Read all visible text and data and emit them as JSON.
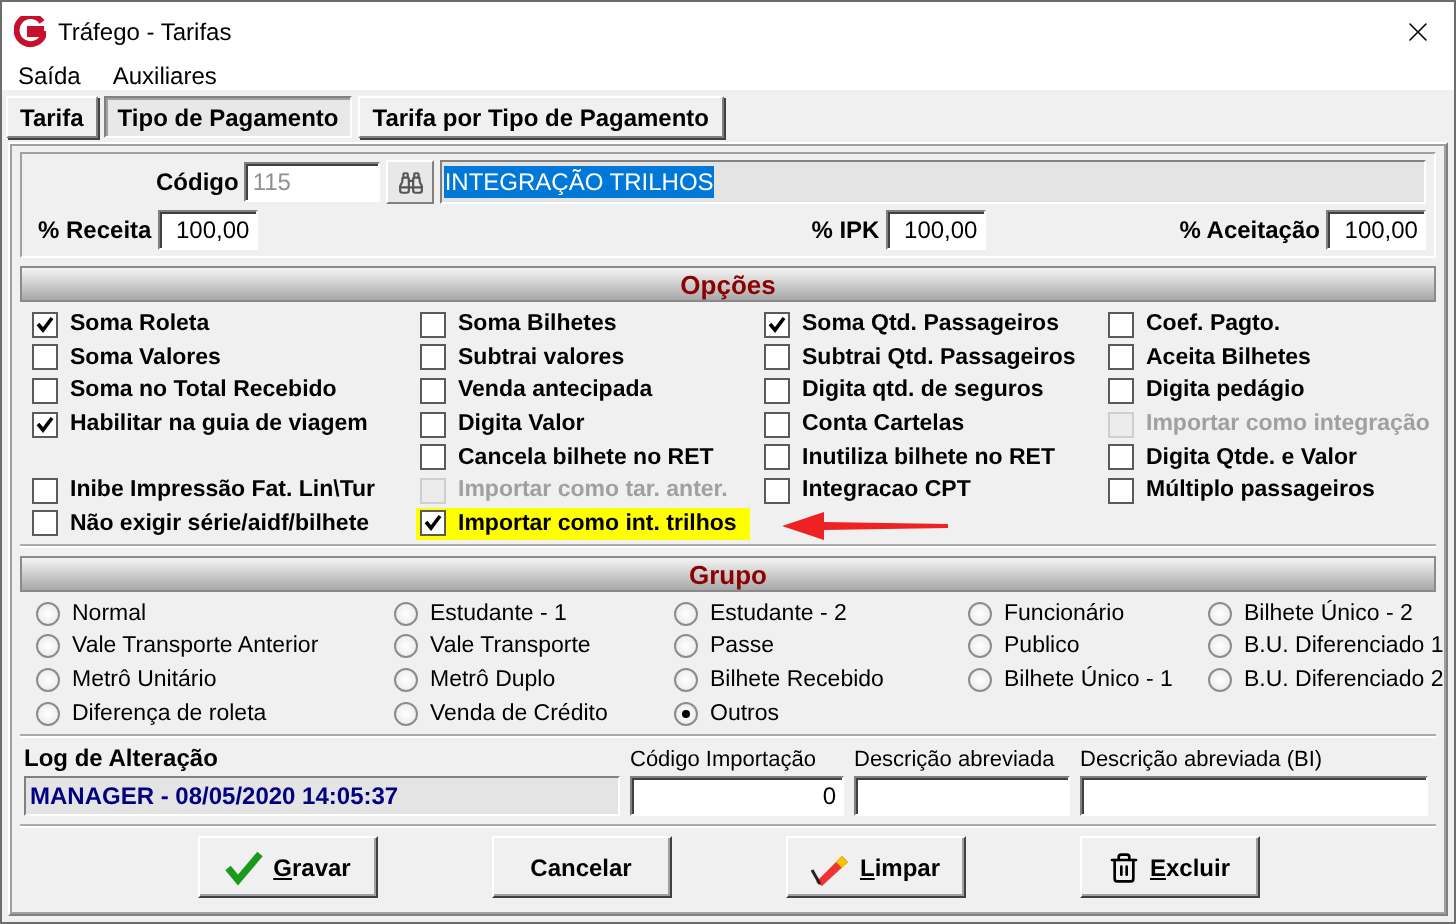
{
  "window": {
    "title": "Tráfego - Tarifas"
  },
  "menu": [
    "Saída",
    "Auxiliares"
  ],
  "tabs": [
    {
      "label": "Tarifa",
      "selected": false
    },
    {
      "label": "Tipo de Pagamento",
      "selected": true
    },
    {
      "label": "Tarifa por Tipo de Pagamento",
      "selected": false
    }
  ],
  "header": {
    "code_label": "Código",
    "code": "115",
    "description": "INTEGRAÇÃO TRILHOS",
    "fields": [
      {
        "label": "% Receita",
        "value": "100,00"
      },
      {
        "label": "% IPK",
        "value": "100,00"
      },
      {
        "label": "% Aceitação",
        "value": "100,00"
      }
    ]
  },
  "options": {
    "title": "Opções",
    "columns": [
      {
        "items": [
          {
            "label": "Soma Roleta",
            "checked": true,
            "disabled": false,
            "highlighted": false
          },
          {
            "label": "Soma Valores",
            "checked": false,
            "disabled": false,
            "highlighted": false
          },
          {
            "label": "Soma no Total Recebido",
            "checked": false,
            "disabled": false,
            "highlighted": false
          },
          {
            "label": "Habilitar na guia de viagem",
            "checked": true,
            "disabled": false,
            "highlighted": false
          }
        ],
        "lower_items": [
          {
            "label": "Inibe Impressão Fat. Lin\\Tur",
            "checked": false,
            "disabled": false,
            "highlighted": false
          },
          {
            "label": "Não exigir série/aidf/bilhete",
            "checked": false,
            "disabled": false,
            "highlighted": false
          }
        ]
      },
      {
        "items": [
          {
            "label": "Soma Bilhetes",
            "checked": false,
            "disabled": false,
            "highlighted": false
          },
          {
            "label": "Subtrai valores",
            "checked": false,
            "disabled": false,
            "highlighted": false
          },
          {
            "label": "Venda antecipada",
            "checked": false,
            "disabled": false,
            "highlighted": false
          },
          {
            "label": "Digita Valor",
            "checked": false,
            "disabled": false,
            "highlighted": false
          },
          {
            "label": "Cancela bilhete no RET",
            "checked": false,
            "disabled": false,
            "highlighted": false
          },
          {
            "label": "Importar como tar. anter.",
            "checked": false,
            "disabled": true,
            "highlighted": false
          },
          {
            "label": "Importar como int. trilhos",
            "checked": true,
            "disabled": false,
            "highlighted": true
          }
        ]
      },
      {
        "items": [
          {
            "label": "Soma Qtd. Passageiros",
            "checked": true,
            "disabled": false,
            "highlighted": false
          },
          {
            "label": "Subtrai Qtd. Passageiros",
            "checked": false,
            "disabled": false,
            "highlighted": false
          },
          {
            "label": "Digita qtd. de seguros",
            "checked": false,
            "disabled": false,
            "highlighted": false
          },
          {
            "label": "Conta Cartelas",
            "checked": false,
            "disabled": false,
            "highlighted": false
          },
          {
            "label": "Inutiliza bilhete no RET",
            "checked": false,
            "disabled": false,
            "highlighted": false
          },
          {
            "label": "Integracao CPT",
            "checked": false,
            "disabled": false,
            "highlighted": false
          }
        ]
      },
      {
        "items": [
          {
            "label": "Coef. Pagto.",
            "checked": false,
            "disabled": false,
            "highlighted": false
          },
          {
            "label": "Aceita Bilhetes",
            "checked": false,
            "disabled": false,
            "highlighted": false
          },
          {
            "label": "Digita pedágio",
            "checked": false,
            "disabled": false,
            "highlighted": false
          },
          {
            "label": "Importar como integração",
            "checked": false,
            "disabled": true,
            "highlighted": false
          },
          {
            "label": "Digita Qtde. e Valor",
            "checked": false,
            "disabled": false,
            "highlighted": false
          },
          {
            "label": "Múltiplo passageiros",
            "checked": false,
            "disabled": false,
            "highlighted": false
          }
        ]
      }
    ]
  },
  "group": {
    "title": "Grupo",
    "columns": [
      [
        {
          "label": "Normal",
          "selected": false
        },
        {
          "label": "Vale Transporte Anterior",
          "selected": false
        },
        {
          "label": "Metrô Unitário",
          "selected": false
        },
        {
          "label": "Diferença de roleta",
          "selected": false
        }
      ],
      [
        {
          "label": "Estudante - 1",
          "selected": false
        },
        {
          "label": "Vale Transporte",
          "selected": false
        },
        {
          "label": "Metrô Duplo",
          "selected": false
        },
        {
          "label": "Venda de Crédito",
          "selected": false
        }
      ],
      [
        {
          "label": "Estudante - 2",
          "selected": false
        },
        {
          "label": "Passe",
          "selected": false
        },
        {
          "label": "Bilhete Recebido",
          "selected": false
        },
        {
          "label": "Outros",
          "selected": true
        }
      ],
      [
        {
          "label": "Funcionário",
          "selected": false
        },
        {
          "label": "Publico",
          "selected": false
        },
        {
          "label": "Bilhete Único - 1",
          "selected": false
        }
      ],
      [
        {
          "label": "Bilhete Único - 2",
          "selected": false
        },
        {
          "label": "B.U. Diferenciado 1",
          "selected": false
        },
        {
          "label": "B.U. Diferenciado 2",
          "selected": false
        }
      ]
    ]
  },
  "log": {
    "label": "Log de Alteração",
    "value": "MANAGER - 08/05/2020 14:05:37"
  },
  "fields": [
    {
      "label": "Código Importação",
      "value": "0"
    },
    {
      "label": "Descrição abreviada"
    },
    {
      "label": "Descrição abreviada (BI)"
    }
  ],
  "buttons": [
    {
      "label": "Gravar",
      "kind": "save",
      "underlined_initial": true
    },
    {
      "label": "Cancelar",
      "kind": "cancel",
      "underlined_initial": false
    },
    {
      "label": "Limpar",
      "kind": "clear",
      "underlined_initial": true
    },
    {
      "label": "Excluir",
      "kind": "delete",
      "underlined_initial": true
    }
  ]
}
